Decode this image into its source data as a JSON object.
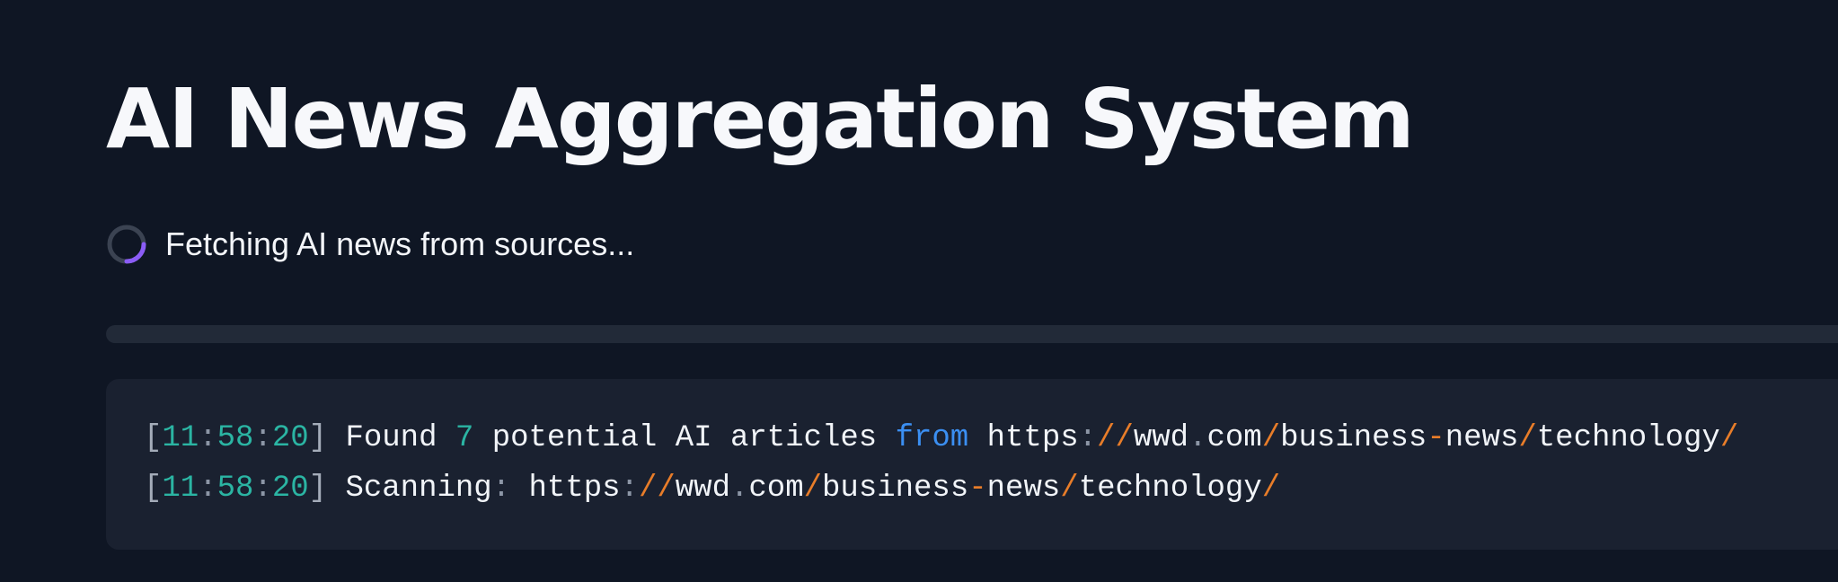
{
  "page": {
    "title": "AI News Aggregation System"
  },
  "status": {
    "text": "Fetching AI news from sources...",
    "spinner_icon": "spinner-icon",
    "spinner_color": "#8b5cf6",
    "spinner_track_color": "#3b4352"
  },
  "progress": {
    "value": 0.0
  },
  "log": {
    "lines": [
      {
        "time": "11:58:20",
        "message": "Found 7 potential AI articles from https://wwd.com/business-news/technology/"
      },
      {
        "time": "11:58:20",
        "message": "Scanning: https://wwd.com/business-news/technology/"
      }
    ]
  },
  "colors": {
    "background": "#0f1624",
    "log_panel": "#1a2130",
    "timestamp": "#2bb5a3",
    "keyword": "#3b8ff2",
    "url_separator": "#e87d29",
    "progress_track": "#222a38"
  }
}
